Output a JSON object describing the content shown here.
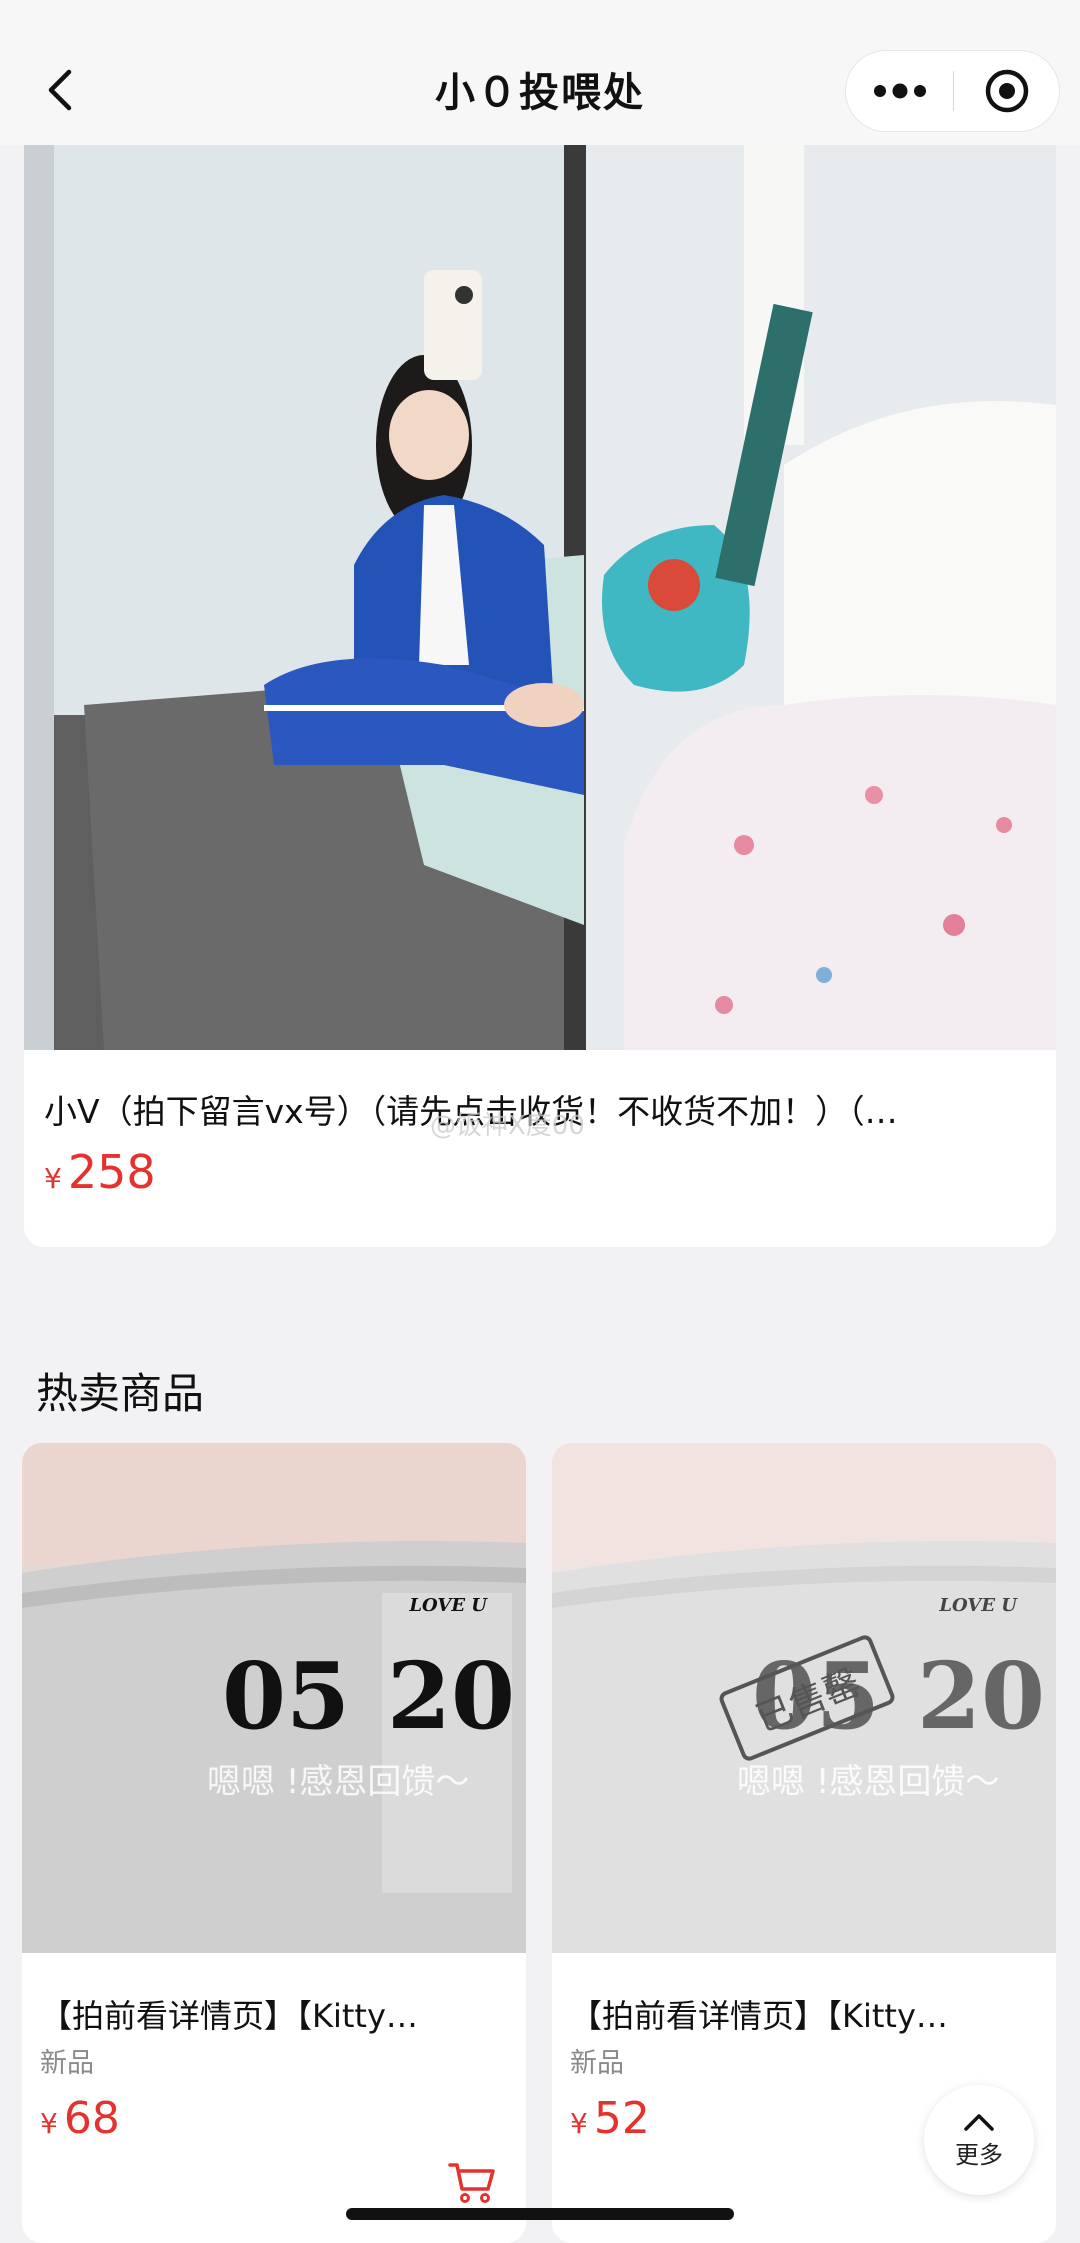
{
  "navbar": {
    "title": "小０投喂处",
    "back_icon": "chevron-left-icon",
    "more_icon": "more-dots-icon",
    "close_icon": "target-circle-icon"
  },
  "featured": {
    "title": "小V（拍下留言vx号）（请先点击收货！不收货不加！）（…",
    "currency": "¥",
    "price": "258",
    "watermark": "@饭神X度00"
  },
  "hot_section": {
    "title": "热卖商品",
    "products": [
      {
        "title": "【拍前看详情页】【Kitty…",
        "tag": "新品",
        "currency": "¥",
        "price": "68",
        "image_text": {
          "brand": "LOVE U",
          "date_left": "05",
          "date_right": "20",
          "caption": "嗯嗯 !感恩回馈～"
        },
        "sold_out": ""
      },
      {
        "title": "【拍前看详情页】【Kitty…",
        "tag": "新品",
        "currency": "¥",
        "price": "52",
        "image_text": {
          "brand": "LOVE U",
          "date_left": "05",
          "date_right": "20",
          "caption": "嗯嗯 !感恩回馈～"
        },
        "sold_out": "已售罄"
      }
    ]
  },
  "more_button": {
    "label": "更多",
    "icon": "chevron-up-icon"
  },
  "colors": {
    "price": "#e5322e",
    "background": "#f2f2f4",
    "card": "#ffffff"
  }
}
